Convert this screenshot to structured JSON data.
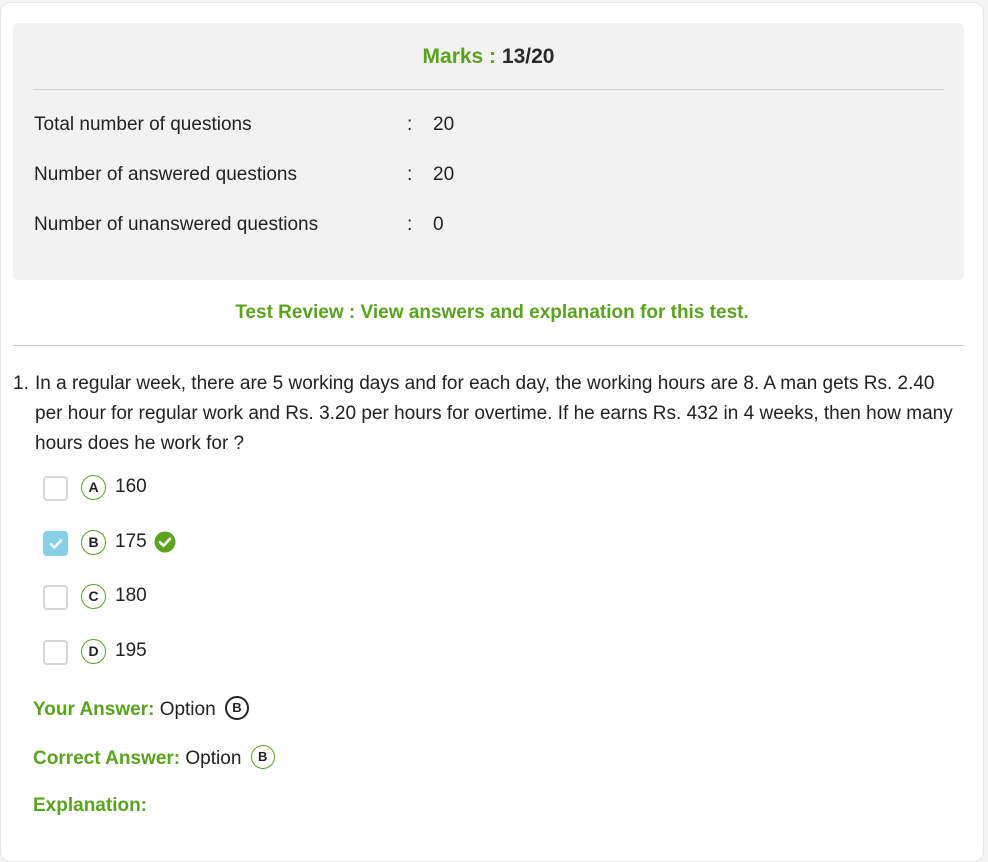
{
  "summary": {
    "marks_label": "Marks :",
    "marks_value": "13/20",
    "rows": [
      {
        "label": "Total number of questions",
        "colon": ":",
        "value": "20"
      },
      {
        "label": "Number of answered questions",
        "colon": ":",
        "value": "20"
      },
      {
        "label": "Number of unanswered questions",
        "colon": ":",
        "value": "0"
      }
    ]
  },
  "review_link": "Test Review : View answers and explanation for this test.",
  "question": {
    "number": "1.",
    "text": "In a regular week, there are 5 working days and for each day, the working hours are 8. A man gets Rs. 2.40 per hour for regular work and Rs. 3.20 per hours for overtime. If he earns Rs. 432 in 4 weeks, then how many hours does he work for ?",
    "options": [
      {
        "letter": "A",
        "text": "160",
        "checked": false,
        "correct": false
      },
      {
        "letter": "B",
        "text": "175",
        "checked": true,
        "correct": true
      },
      {
        "letter": "C",
        "text": "180",
        "checked": false,
        "correct": false
      },
      {
        "letter": "D",
        "text": "195",
        "checked": false,
        "correct": false
      }
    ]
  },
  "your_answer": {
    "label": "Your Answer:",
    "prefix": "Option",
    "letter": "B"
  },
  "correct_answer": {
    "label": "Correct Answer:",
    "prefix": "Option",
    "letter": "B"
  },
  "explanation": {
    "label": "Explanation:"
  },
  "colors": {
    "accent_green": "#5aa31e",
    "checkbox_checked": "#86cfe6",
    "panel_bg": "#f2f2f2"
  }
}
